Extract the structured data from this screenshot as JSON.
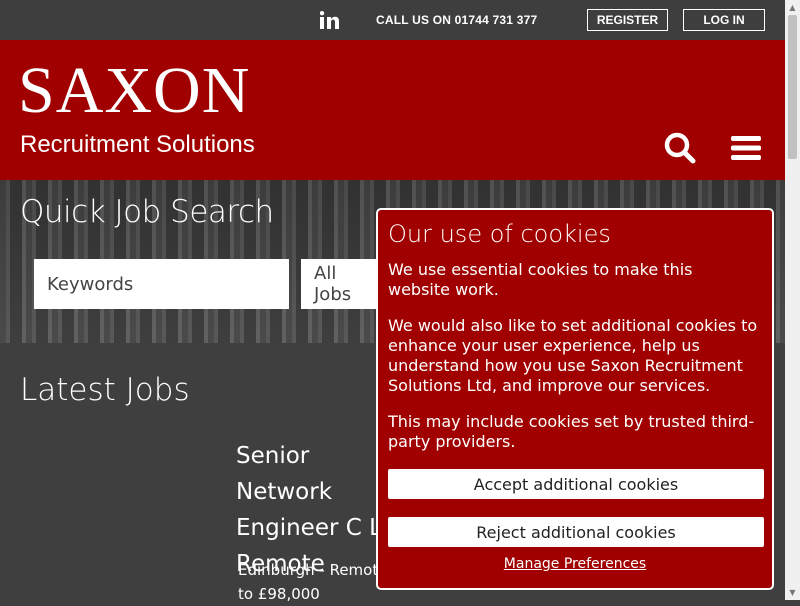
{
  "topbar": {
    "linkedin_icon": "linkedin-icon",
    "call_text": "CALL US ON 01744 731 377",
    "register_label": "REGISTER",
    "login_label": "LOG IN"
  },
  "header": {
    "logo_main": "SAXON",
    "logo_sub": "Recruitment Solutions",
    "brand_color": "#a00000"
  },
  "hero": {
    "title": "Quick Job Search",
    "keywords_placeholder": "Keywords",
    "jobs_select_value": "All Jobs"
  },
  "latest": {
    "title": "Latest Jobs",
    "job_title": "Senior Network Engineer C L Remote",
    "job_meta": "Edinburgh - Remote to £98,000"
  },
  "cookie": {
    "title": "Our use of cookies",
    "p1": "We use essential cookies to make this website work.",
    "p2": "We would also like to set additional cookies to enhance your user experience, help us understand how you use Saxon Recruitment Solutions Ltd, and improve our services.",
    "p3": "This may include cookies set by trusted third-party providers.",
    "accept_label": "Accept additional cookies",
    "reject_label": "Reject additional cookies",
    "manage_label": "Manage Preferences"
  }
}
